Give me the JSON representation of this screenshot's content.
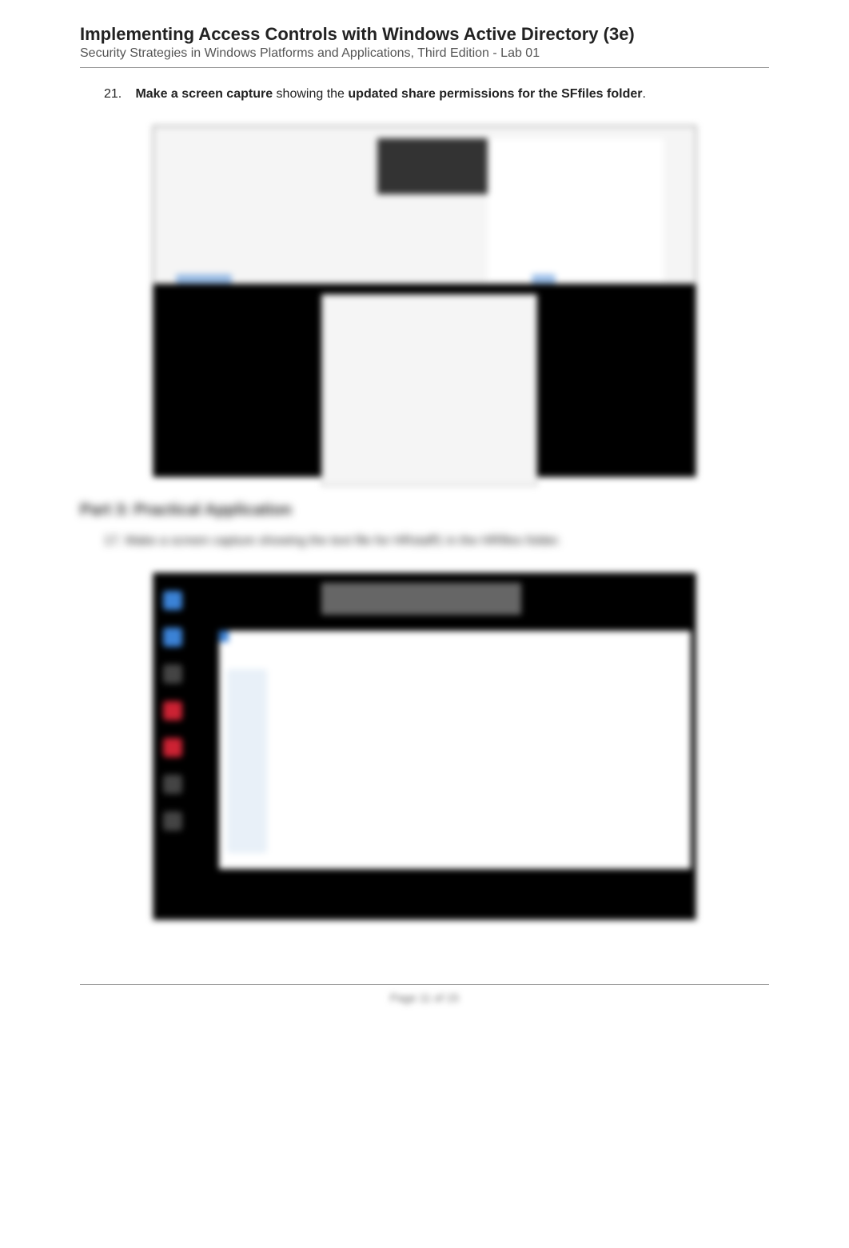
{
  "header": {
    "title": "Implementing Access Controls with Windows Active Directory (3e)",
    "subtitle": "Security Strategies in Windows Platforms and Applications, Third Edition - Lab 01"
  },
  "instruction1": {
    "num": "21.",
    "bold1": "Make a screen capture",
    "mid": " showing the ",
    "bold2": "updated share permissions for the SFfiles folder",
    "end": "."
  },
  "section": {
    "heading": "Part 3: Practical Application"
  },
  "instruction2": {
    "num": "17.",
    "bold1": "Make a screen capture",
    "mid": " showing the text file for HRstaff1 in the HRfiles folder",
    "end": "."
  },
  "footer": {
    "text": "Page 11 of 15"
  }
}
